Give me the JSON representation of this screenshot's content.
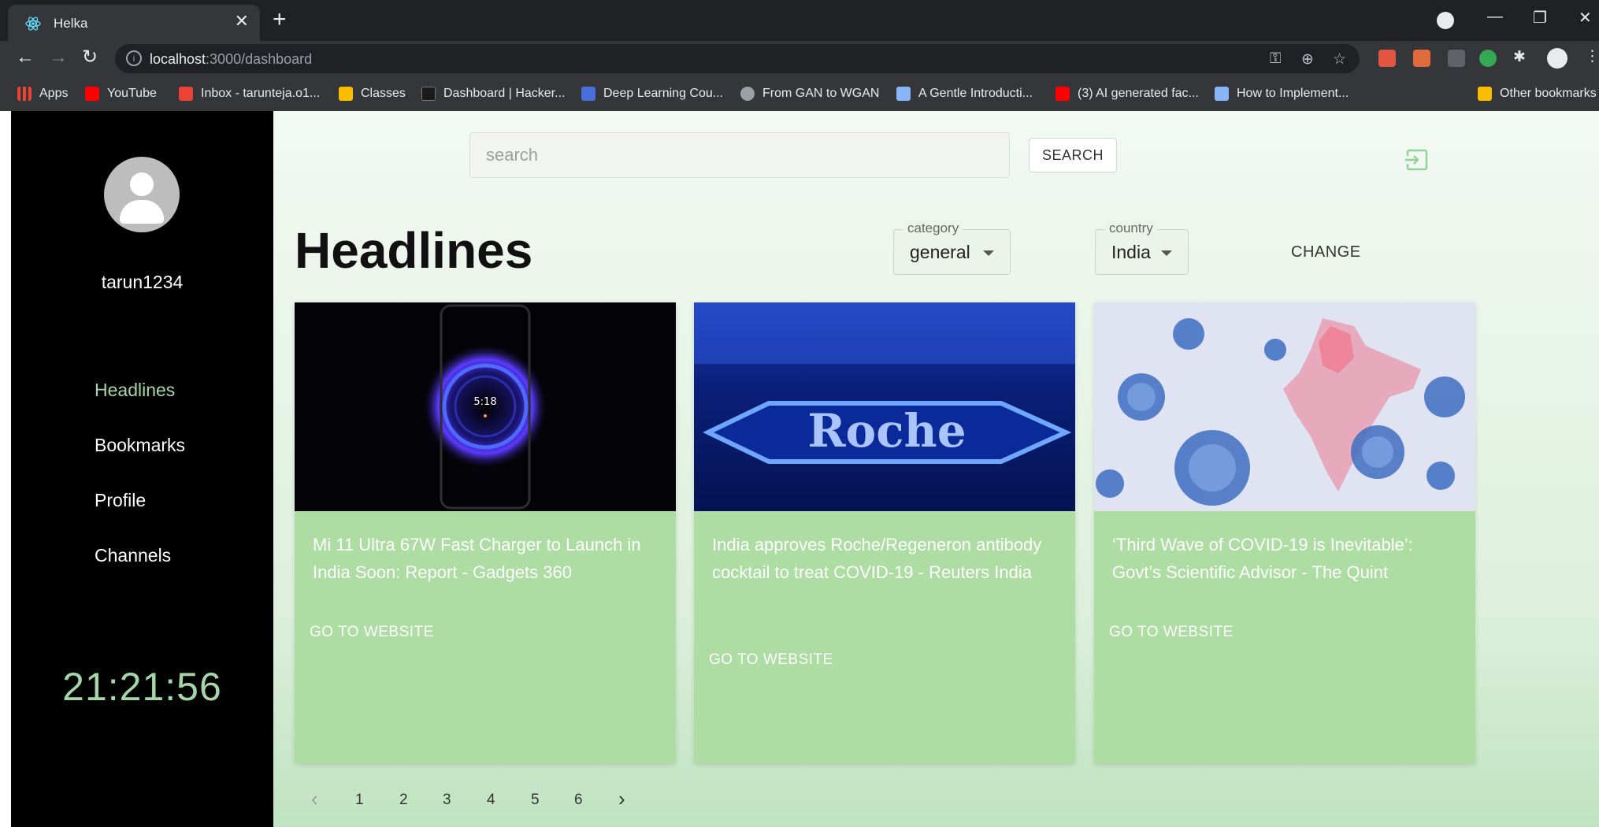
{
  "browser": {
    "tab_title": "Helka",
    "url_host": "localhost",
    "url_path": ":3000/dashboard",
    "bookmarks": [
      {
        "label": "Apps",
        "color": "#ea4335"
      },
      {
        "label": "YouTube",
        "color": "#ff0000"
      },
      {
        "label": "Inbox - tarunteja.o1...",
        "color": "#ea4335"
      },
      {
        "label": "Classes",
        "color": "#fbbc04"
      },
      {
        "label": "Dashboard | Hacker...",
        "color": "#1a1a1a"
      },
      {
        "label": "Deep Learning Cou...",
        "color": "#4a6fd8"
      },
      {
        "label": "From GAN to WGAN",
        "color": "#9aa0a6"
      },
      {
        "label": "A Gentle Introducti...",
        "color": "#8ab4f8"
      },
      {
        "label": "(3) AI generated fac...",
        "color": "#ff0000"
      },
      {
        "label": "How to Implement...",
        "color": "#8ab4f8"
      }
    ],
    "other_bookmarks": "Other bookmarks"
  },
  "sidebar": {
    "username": "tarun1234",
    "nav": [
      "Headlines",
      "Bookmarks",
      "Profile",
      "Channels"
    ],
    "active_nav": "Headlines",
    "clock": "21:21:56"
  },
  "search": {
    "placeholder": "search",
    "button_label": "SEARCH"
  },
  "headlines": {
    "title": "Headlines",
    "category": {
      "label": "category",
      "value": "general"
    },
    "country": {
      "label": "country",
      "value": "India"
    },
    "change_label": "CHANGE"
  },
  "cards": [
    {
      "headline": "Mi 11 Ultra 67W Fast Charger to Launch in India Soon: Report - Gadgets 360",
      "link_label": "GO TO WEBSITE",
      "image": "phone-charger-image"
    },
    {
      "headline": "India approves Roche/Regeneron antibody cocktail to treat COVID-19 - Reuters India",
      "link_label": "GO TO WEBSITE",
      "image": "roche-logo-image",
      "image_text": "Roche"
    },
    {
      "headline": "‘Third Wave of COVID-19 is Inevitable’: Govt’s Scientific Advisor - The Quint",
      "link_label": "GO TO WEBSITE",
      "image": "covid-india-map-image"
    }
  ],
  "pagination": {
    "prev": "‹",
    "pages": [
      "1",
      "2",
      "3",
      "4",
      "5",
      "6"
    ],
    "next": "›"
  },
  "colors": {
    "accent": "#a5d6a7",
    "card": "#aedda4"
  }
}
